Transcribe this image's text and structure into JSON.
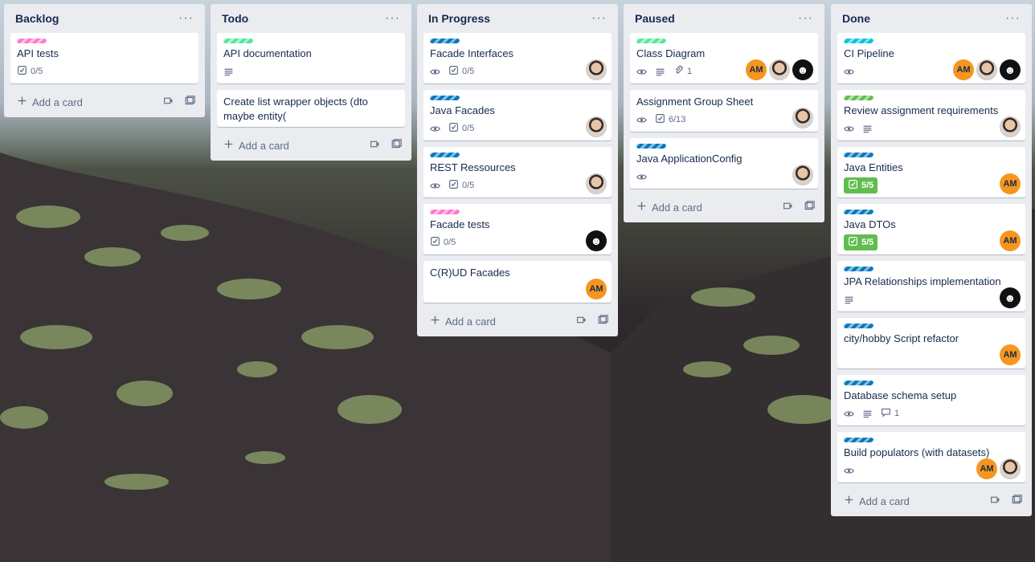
{
  "board": {
    "add_card_label": "Add a card",
    "lists": [
      {
        "title": "Backlog",
        "cards": [
          {
            "title": "API tests",
            "labels": [
              "#ff78cb"
            ],
            "badges": {
              "checklist": "0/5"
            },
            "members": []
          }
        ]
      },
      {
        "title": "Todo",
        "cards": [
          {
            "title": "API documentation",
            "labels": [
              "#51e898"
            ],
            "badges": {
              "description": true
            },
            "members": []
          },
          {
            "title": "Create list wrapper objects (dto maybe entity(",
            "labels": [],
            "badges": {},
            "members": []
          }
        ]
      },
      {
        "title": "In Progress",
        "cards": [
          {
            "title": "Facade Interfaces",
            "labels": [
              "#0079bf"
            ],
            "badges": {
              "watch": true,
              "checklist": "0/5"
            },
            "members": [
              "photo"
            ]
          },
          {
            "title": "Java Facades",
            "labels": [
              "#0079bf"
            ],
            "badges": {
              "watch": true,
              "checklist": "0/5"
            },
            "members": [
              "photo"
            ]
          },
          {
            "title": "REST Ressources",
            "labels": [
              "#0079bf"
            ],
            "badges": {
              "watch": true,
              "checklist": "0/5"
            },
            "members": [
              "photo"
            ]
          },
          {
            "title": "Facade tests",
            "labels": [
              "#ff78cb"
            ],
            "badges": {
              "checklist": "0/5"
            },
            "members": [
              "mask"
            ]
          },
          {
            "title": "C(R)UD Facades",
            "labels": [],
            "badges": {},
            "members": [
              "am"
            ]
          }
        ]
      },
      {
        "title": "Paused",
        "cards": [
          {
            "title": "Class Diagram",
            "labels": [
              "#51e898"
            ],
            "badges": {
              "watch": true,
              "description": true,
              "attachments": "1"
            },
            "members": [
              "am",
              "photo",
              "mask"
            ]
          },
          {
            "title": "Assignment Group Sheet",
            "labels": [],
            "badges": {
              "watch": true,
              "checklist": "6/13"
            },
            "members": [
              "photo"
            ]
          },
          {
            "title": "Java ApplicationConfig",
            "labels": [
              "#0079bf"
            ],
            "badges": {
              "watch": true
            },
            "members": [
              "photo"
            ]
          }
        ]
      },
      {
        "title": "Done",
        "cards": [
          {
            "title": "CI Pipeline",
            "labels": [
              "#00c2e0"
            ],
            "badges": {
              "watch": true
            },
            "members": [
              "am",
              "photo",
              "mask"
            ]
          },
          {
            "title": "Review assignment requirements",
            "labels": [
              "#61bd4f"
            ],
            "badges": {
              "watch": true,
              "description": true
            },
            "members": [
              "photo"
            ]
          },
          {
            "title": "Java Entities",
            "labels": [
              "#0079bf"
            ],
            "badges": {
              "checklist_done": "5/5"
            },
            "members": [
              "am"
            ]
          },
          {
            "title": "Java DTOs",
            "labels": [
              "#0079bf"
            ],
            "badges": {
              "checklist_done": "5/5"
            },
            "members": [
              "am"
            ]
          },
          {
            "title": "JPA Relationships implementation",
            "labels": [
              "#0079bf"
            ],
            "badges": {
              "description": true
            },
            "members": [
              "mask"
            ]
          },
          {
            "title": "city/hobby Script refactor",
            "labels": [
              "#0079bf"
            ],
            "badges": {},
            "members": [
              "am"
            ]
          },
          {
            "title": "Database schema setup",
            "labels": [
              "#0079bf"
            ],
            "badges": {
              "watch": true,
              "description": true,
              "comments": "1"
            },
            "members": []
          },
          {
            "title": "Build populators (with datasets)",
            "labels": [
              "#0079bf"
            ],
            "badges": {
              "watch": true
            },
            "members": [
              "am",
              "photo"
            ]
          }
        ]
      }
    ]
  },
  "avatars": {
    "am": "AM"
  },
  "icons": {
    "list_menu": "ellipsis-icon",
    "add": "plus-icon",
    "template": "template-icon",
    "card_composer": "card-composer-icon"
  }
}
